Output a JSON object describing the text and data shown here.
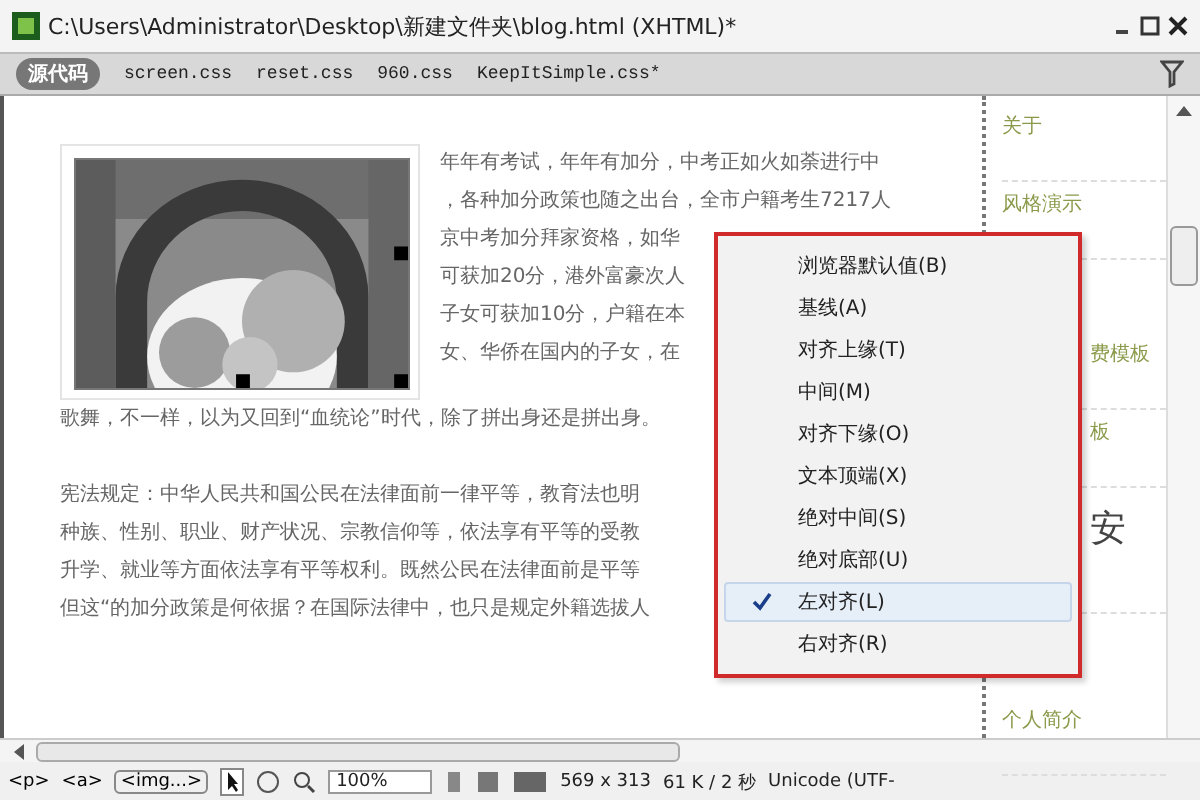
{
  "window": {
    "title": "C:\\Users\\Administrator\\Desktop\\新建文件夹\\blog.html (XHTML)*"
  },
  "tabs": [
    {
      "label": "源代码",
      "kind": "source",
      "selected": true
    },
    {
      "label": "screen.css",
      "kind": "file",
      "selected": false
    },
    {
      "label": "reset.css",
      "kind": "file",
      "selected": false
    },
    {
      "label": "960.css",
      "kind": "file",
      "selected": false
    },
    {
      "label": "KeepItSimple.css*",
      "kind": "file",
      "selected": false
    }
  ],
  "article": {
    "beside_image": [
      "年年有考试，年年有加分，中考正如火如荼进行中",
      "，各种加分政策也随之出台，全市户籍考生7217人",
      "京中考加分拜家资格，如华",
      "可获加20分，港外富豪次人",
      "子女可获加10分，户籍在本",
      "女、华侨在国内的子女，在"
    ],
    "paragraphs": [
      "歌舞，不一样，以为又回到“血统论”时代，除了拼出身还是拼出身。",
      "宪法规定：中华人民共和国公民在法律面前一律平等，教育法也明",
      "种族、性别、职业、财产状况、宗教信仰等，依法享有平等的受教",
      "升学、就业等方面依法享有平等权利。既然公民在法律面前是平等",
      "但这“的加分政策是何依据？在国际法律中，也只是规定外籍选拔人"
    ]
  },
  "sidebar": {
    "items": [
      {
        "label": "关于",
        "kind": "link"
      },
      {
        "label": "风格演示",
        "kind": "link"
      },
      {
        "label": "费模板",
        "kind": "cut_link"
      },
      {
        "label": "板",
        "kind": "cut_link"
      },
      {
        "label": "安",
        "kind": "cut_heading"
      },
      {
        "label": "个人简介",
        "kind": "link"
      }
    ]
  },
  "context_menu": {
    "items": [
      {
        "label": "浏览器默认值(B)",
        "checked": false
      },
      {
        "label": "基线(A)",
        "checked": false
      },
      {
        "label": "对齐上缘(T)",
        "checked": false
      },
      {
        "label": "中间(M)",
        "checked": false
      },
      {
        "label": "对齐下缘(O)",
        "checked": false
      },
      {
        "label": "文本顶端(X)",
        "checked": false
      },
      {
        "label": "绝对中间(S)",
        "checked": false
      },
      {
        "label": "绝对底部(U)",
        "checked": false
      },
      {
        "label": "左对齐(L)",
        "checked": true
      },
      {
        "label": "右对齐(R)",
        "checked": false
      }
    ]
  },
  "status_bar": {
    "tags": [
      "<p>",
      "<a>",
      "<img...>"
    ],
    "zoom": "100%",
    "size": "569 x 313",
    "download": "61 K / 2 秒",
    "encoding": "Unicode (UTF-"
  }
}
